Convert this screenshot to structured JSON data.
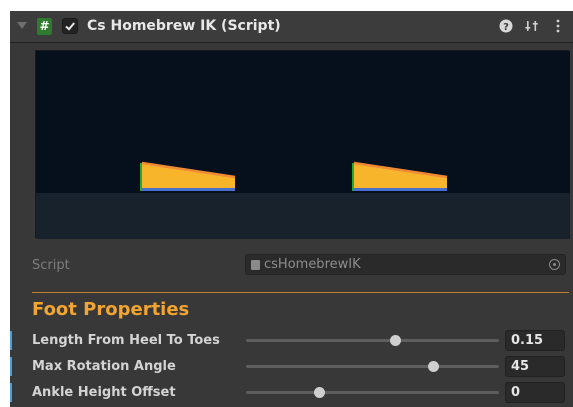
{
  "header": {
    "title": "Cs Homebrew IK (Script)",
    "enabled": true,
    "icons": [
      "foldout-arrow-icon",
      "script-file-icon",
      "checkbox-icon",
      "help-icon",
      "preset-icon",
      "kebab-menu-icon"
    ]
  },
  "preview": {
    "feet_count": 2,
    "colors": {
      "background": "#05101c",
      "ground": "#17222d",
      "foot_fill": "#f7b52c",
      "foot_edge": "#f08a35",
      "sole": "#4a6fcb",
      "heel_marker": "#2da52d"
    }
  },
  "script": {
    "label": "Script",
    "value": "csHomebrewIK"
  },
  "section": {
    "title": "Foot Properties"
  },
  "properties": [
    {
      "label": "Length From Heel To Toes",
      "value": "0.15",
      "slider_fraction": 0.59
    },
    {
      "label": "Max Rotation Angle",
      "value": "45",
      "slider_fraction": 0.74
    },
    {
      "label": "Ankle Height Offset",
      "value": "0",
      "slider_fraction": 0.29
    }
  ],
  "colors": {
    "accent": "#f2a531",
    "panel": "#383838",
    "selection_bar": "#4a9ee0"
  }
}
